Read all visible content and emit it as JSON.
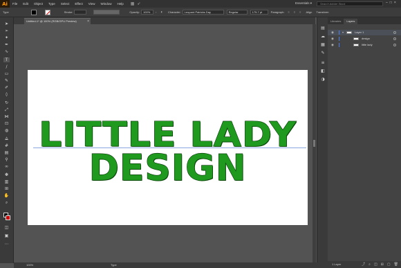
{
  "app": {
    "logo": "Ai"
  },
  "menu": [
    "File",
    "Edit",
    "Object",
    "Type",
    "Select",
    "Effect",
    "View",
    "Window",
    "Help"
  ],
  "workspace": {
    "label": "Essentials",
    "chevron": "▾"
  },
  "search": {
    "placeholder": "Search Adobe Stock"
  },
  "window_controls": [
    "–",
    "□",
    "×"
  ],
  "controlbar": {
    "mode": "Type",
    "stroke_label": "Stroke:",
    "opacity_label": "Opacity:",
    "opacity_value": "100%",
    "character_label": "Character:",
    "font_family": "Leopard Patricks Day",
    "font_style": "Regular",
    "font_size": "175.7 pt",
    "paragraph_label": "Paragraph:",
    "align_label": "Align",
    "transform_label": "Transform"
  },
  "document": {
    "tab_title": "Untitled-1* @ 100% (RGB/GPU Preview)",
    "close": "×"
  },
  "artwork": {
    "line1": "LITTLE LADY",
    "line2": "DESIGN",
    "fill_color": "#1f9a1f"
  },
  "panel": {
    "tabs": [
      "Libraries",
      "Layers"
    ],
    "active_tab": "Layers",
    "layers": [
      {
        "name": "Layer 1",
        "level": 0,
        "expanded": true
      },
      {
        "name": "design",
        "level": 1
      },
      {
        "name": "little lady",
        "level": 1
      }
    ],
    "footer_count": "1 Layer"
  },
  "statusbar": {
    "zoom": "100%",
    "tool": "Type"
  },
  "tools": [
    "selection",
    "direct-selection",
    "magic-wand",
    "lasso",
    "pen",
    "curvature",
    "type",
    "line",
    "rectangle",
    "paintbrush",
    "shaper",
    "pencil",
    "eraser",
    "rotate",
    "scale",
    "width",
    "free-transform",
    "shape-builder",
    "perspective",
    "mesh",
    "gradient",
    "eyedropper",
    "blend",
    "symbol-sprayer",
    "column-graph",
    "artboard",
    "slice",
    "hand",
    "zoom"
  ]
}
